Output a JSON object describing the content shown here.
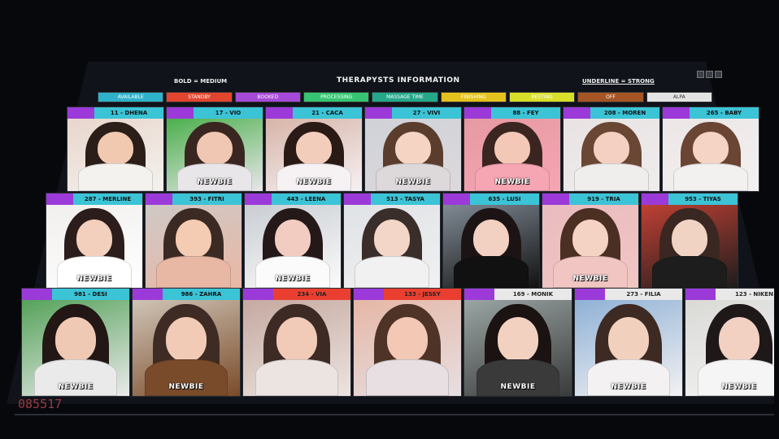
{
  "topbar": {
    "left_note": "BOLD = MEDIUM",
    "title": "THERAPYSTS INFORMATION",
    "right_note": "UNDERLINE = STRONG"
  },
  "legend": [
    {
      "label": "AVAILABLE",
      "color": "#2fb2c9"
    },
    {
      "label": "STANDBY",
      "color": "#e2452f"
    },
    {
      "label": "BOOKED",
      "color": "#a64ad8"
    },
    {
      "label": "PROCESSING",
      "color": "#36c472"
    },
    {
      "label": "MASSAGE TIME",
      "color": "#25a88a"
    },
    {
      "label": "FINISHING",
      "color": "#e4c21e"
    },
    {
      "label": "RESTING",
      "color": "#d8df2a"
    },
    {
      "label": "OFF",
      "color": "#a55525"
    },
    {
      "label": "ALPA",
      "color": "#e3e3e3"
    }
  ],
  "rows": [
    [
      {
        "name": "11 - DHENA",
        "status": "cyan",
        "newbie": ""
      },
      {
        "name": "17 - VIO",
        "status": "cyan",
        "newbie": "NEWBIE"
      },
      {
        "name": "21 - CACA",
        "status": "cyan",
        "newbie": "NEWBIE"
      },
      {
        "name": "27 - VIVI",
        "status": "cyan",
        "newbie": "NEWBIE"
      },
      {
        "name": "88 - FEY",
        "status": "cyan",
        "newbie": "NEWBIE"
      },
      {
        "name": "208 - MOREN",
        "status": "cyan",
        "newbie": ""
      },
      {
        "name": "265 - BABY",
        "status": "cyan",
        "newbie": ""
      }
    ],
    [
      {
        "name": "287 - MERLINE",
        "status": "cyan",
        "newbie": "NEWBIE"
      },
      {
        "name": "393 - FITRI",
        "status": "cyan",
        "newbie": ""
      },
      {
        "name": "443 - LEENA",
        "status": "cyan",
        "newbie": "NEWBIE"
      },
      {
        "name": "513 - TASYA",
        "status": "cyan",
        "newbie": ""
      },
      {
        "name": "635 - LUSI",
        "status": "cyan",
        "newbie": ""
      },
      {
        "name": "919 - TRIA",
        "status": "cyan",
        "newbie": "NEWBIE"
      },
      {
        "name": "953 - TIYAS",
        "status": "cyan",
        "newbie": ""
      }
    ],
    [
      {
        "name": "981 - DESI",
        "status": "cyan",
        "newbie": "NEWBIE"
      },
      {
        "name": "986 - ZAHRA",
        "status": "cyan",
        "newbie": "NEWBIE"
      },
      {
        "name": "234 - VIA",
        "status": "red",
        "newbie": ""
      },
      {
        "name": "133 - JESSY",
        "status": "red",
        "newbie": ""
      },
      {
        "name": "169 - MONIK",
        "status": "white",
        "newbie": "NEWBIE"
      },
      {
        "name": "273 - FILIA",
        "status": "white",
        "newbie": "NEWBIE"
      },
      {
        "name": "123 - NIKEN",
        "status": "white",
        "newbie": "NEWBIE"
      }
    ]
  ],
  "footer": {
    "code": "085517"
  }
}
